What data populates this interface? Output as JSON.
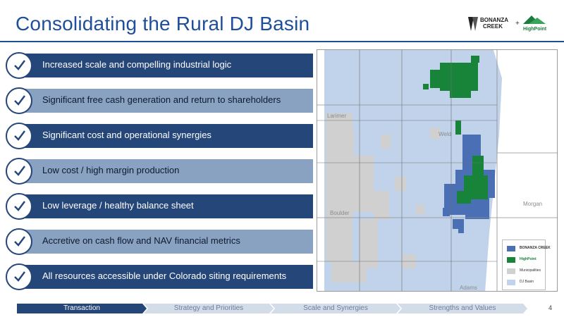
{
  "slide": {
    "title": "Consolidating the Rural DJ Basin",
    "page_number": "4"
  },
  "logo": {
    "primary_line1": "BONANZA",
    "primary_line2": "CREEK",
    "plus": "+",
    "secondary": "HighPoint"
  },
  "bullets": [
    {
      "text": "Increased scale and compelling industrial logic",
      "style": "dark"
    },
    {
      "text": "Significant free cash generation and return to shareholders",
      "style": "light"
    },
    {
      "text": "Significant cost and operational synergies",
      "style": "dark"
    },
    {
      "text": "Low cost / high margin production",
      "style": "light"
    },
    {
      "text": "Low leverage / healthy balance sheet",
      "style": "dark"
    },
    {
      "text": "Accretive on cash flow and NAV financial metrics",
      "style": "light"
    },
    {
      "text": "All resources accessible under Colorado siting requirements",
      "style": "dark"
    }
  ],
  "map": {
    "county_labels": {
      "larimer": "Larimer",
      "weld": "Weld",
      "boulder": "Boulder",
      "morgan": "Morgan",
      "adams": "Adams"
    },
    "legend": {
      "bonanza": "BONANZA CREEK",
      "highpoint": "HighPoint",
      "municipalities": "Municipalities",
      "dj_basin": "DJ Basin"
    },
    "colors": {
      "bonanza": "#4a6fb5",
      "highpoint": "#17843a",
      "municipalities": "#d0d0d0",
      "dj_basin": "#c1d3ea"
    }
  },
  "progress": {
    "steps": [
      "Transaction",
      "Strategy and Priorities",
      "Scale and Synergies",
      "Strengths and Values"
    ],
    "active_index": 0
  },
  "colors": {
    "title": "#1f4e9b",
    "dark_bar": "#254679",
    "light_bar": "#8aa2c2"
  }
}
